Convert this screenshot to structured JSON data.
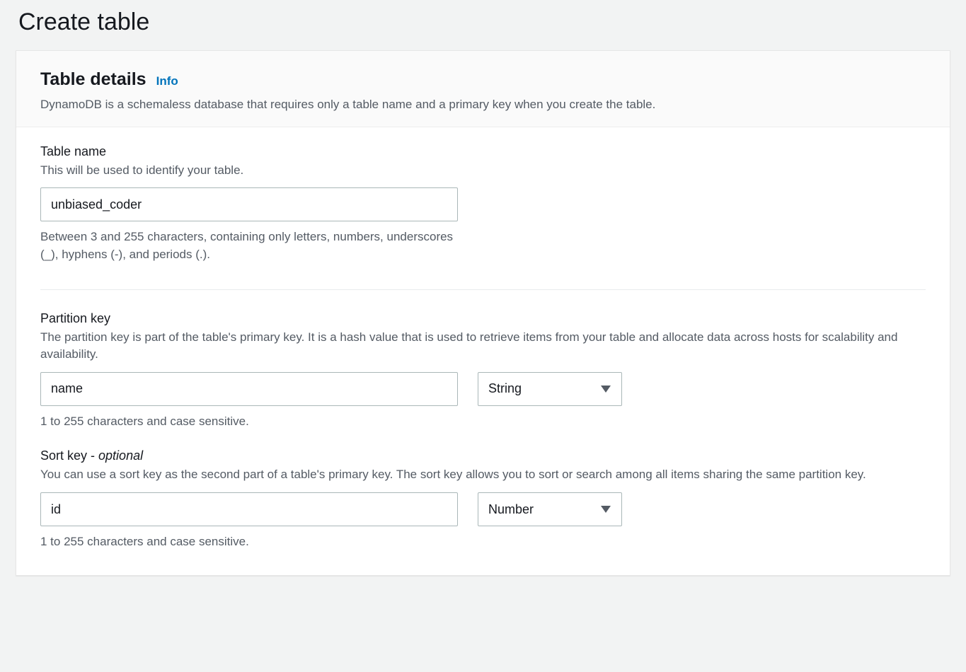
{
  "page": {
    "title": "Create table"
  },
  "panel": {
    "heading": "Table details",
    "info_label": "Info",
    "description": "DynamoDB is a schemaless database that requires only a table name and a primary key when you create the table."
  },
  "table_name": {
    "label": "Table name",
    "hint": "This will be used to identify your table.",
    "value": "unbiased_coder",
    "post_hint": "Between 3 and 255 characters, containing only letters, numbers, underscores (_), hyphens (-), and periods (.)."
  },
  "partition_key": {
    "label": "Partition key",
    "hint": "The partition key is part of the table's primary key. It is a hash value that is used to retrieve items from your table and allocate data across hosts for scalability and availability.",
    "value": "name",
    "type_selected": "String",
    "post_hint": "1 to 255 characters and case sensitive."
  },
  "sort_key": {
    "label_main": "Sort key - ",
    "label_optional": "optional",
    "hint": "You can use a sort key as the second part of a table's primary key. The sort key allows you to sort or search among all items sharing the same partition key.",
    "value": "id",
    "type_selected": "Number",
    "post_hint": "1 to 255 characters and case sensitive."
  }
}
